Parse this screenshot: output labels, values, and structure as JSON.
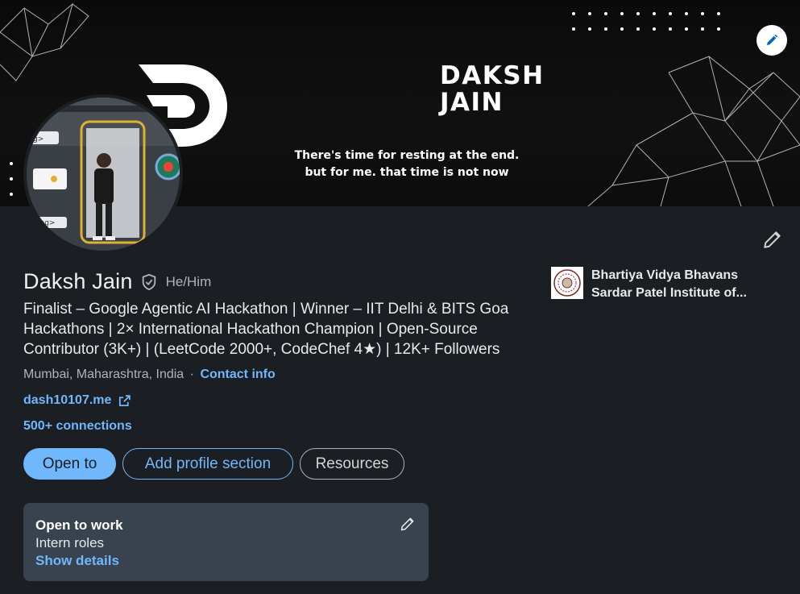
{
  "banner": {
    "title_line1": "DAKSH",
    "title_line2": "JAIN",
    "tagline_line1": "There's time for resting at the end.",
    "tagline_line2": "but for me. that time is not now"
  },
  "profile": {
    "name": "Daksh Jain",
    "pronouns": "He/Him",
    "headline": "Finalist – Google Agentic AI Hackathon | Winner – IIT Delhi & BITS Goa Hackathons | 2× International Hackathon Champion | Open-Source Contributor (3K+) | (LeetCode 2000+, CodeChef 4★) | 12K+ Followers",
    "location": "Mumbai, Maharashtra, India",
    "separator": "·",
    "contact_label": "Contact info",
    "website": "dash10107.me",
    "connections": "500+ connections"
  },
  "actions": {
    "open_to": "Open to",
    "add_section": "Add profile section",
    "resources": "Resources"
  },
  "open_to_work": {
    "title": "Open to work",
    "roles": "Intern roles",
    "details_link": "Show details"
  },
  "education": {
    "line1": "Bhartiya Vidya Bhavans",
    "line2": "Sardar Patel Institute of..."
  },
  "icons": {
    "banner_edit": "pencil-icon",
    "card_edit": "pencil-icon",
    "verified": "shield-check-icon",
    "external": "external-link-icon"
  },
  "colors": {
    "background": "#1b1f23",
    "accent": "#71b7fb",
    "card": "#38434f"
  }
}
